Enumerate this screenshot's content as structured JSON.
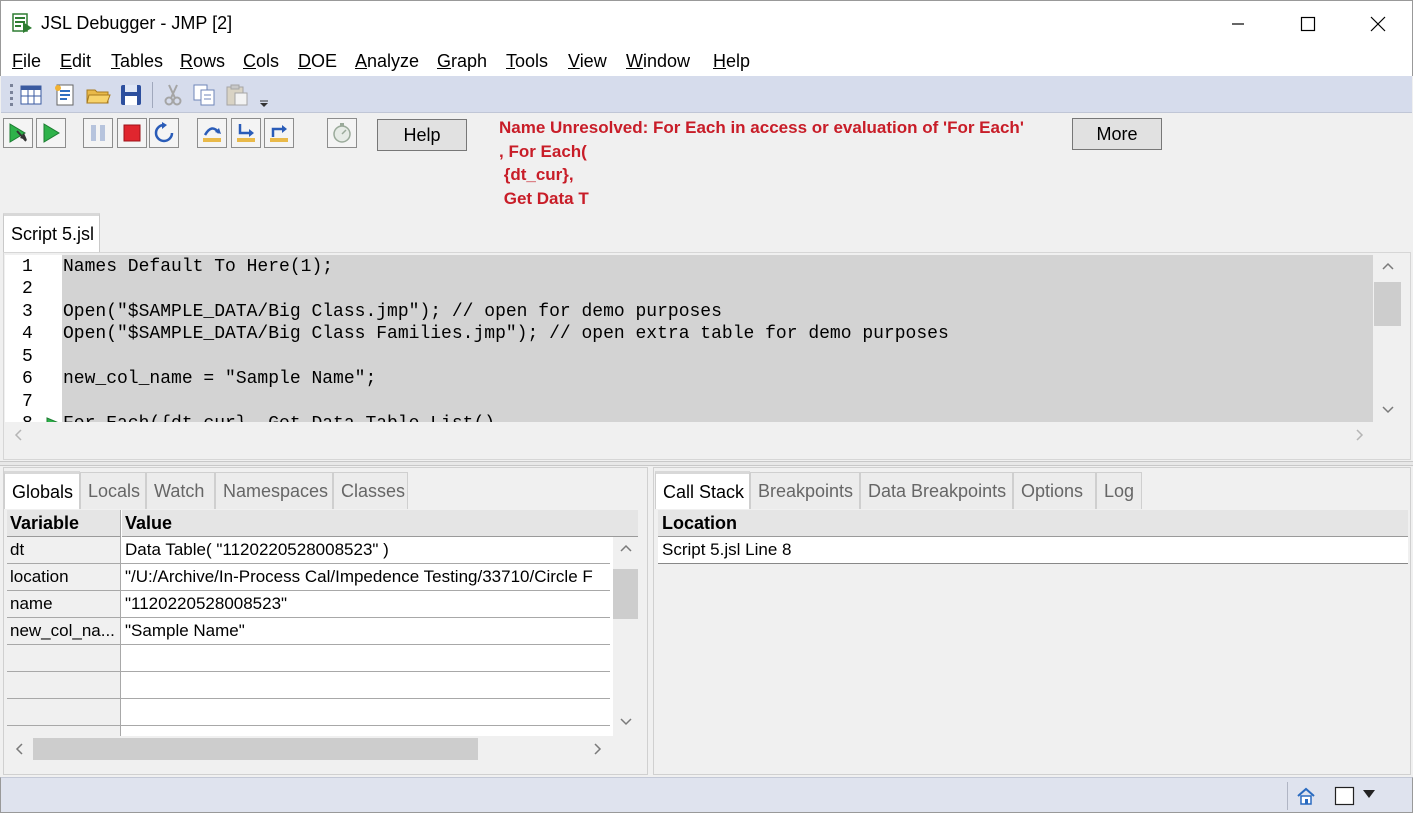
{
  "window": {
    "title": "JSL Debugger - JMP [2]"
  },
  "menu": {
    "items": [
      {
        "u": "F",
        "rest": "ile"
      },
      {
        "u": "E",
        "rest": "dit"
      },
      {
        "u": "T",
        "rest": "ables"
      },
      {
        "u": "R",
        "rest": "ows"
      },
      {
        "u": "C",
        "rest": "ols"
      },
      {
        "u": "D",
        "rest": "OE"
      },
      {
        "u": "A",
        "rest": "nalyze"
      },
      {
        "u": "G",
        "rest": "raph"
      },
      {
        "u": "T",
        "rest": "ools"
      },
      {
        "u": "V",
        "rest": "iew"
      },
      {
        "u": "W",
        "rest": "indow"
      },
      {
        "u": "H",
        "rest": "elp"
      }
    ]
  },
  "debugger": {
    "help_label": "Help",
    "more_label": "More",
    "error_lines": [
      "Name Unresolved: For Each in access or evaluation of 'For Each'",
      ", For Each(",
      " {dt_cur},",
      " Get Data T"
    ]
  },
  "script": {
    "tab_label": "Script 5.jsl",
    "lines": [
      {
        "n": "1",
        "text": "Names Default To Here(1);"
      },
      {
        "n": "2",
        "text": ""
      },
      {
        "n": "3",
        "text": "Open(\"$SAMPLE_DATA/Big Class.jmp\"); // open for demo purposes"
      },
      {
        "n": "4",
        "text": "Open(\"$SAMPLE_DATA/Big Class Families.jmp\"); // open extra table for demo purposes"
      },
      {
        "n": "5",
        "text": ""
      },
      {
        "n": "6",
        "text": "new_col_name = \"Sample Name\";"
      },
      {
        "n": "7",
        "text": ""
      },
      {
        "n": "8",
        "text": "For Each({dt_cur}, Get Data Table List(),"
      }
    ]
  },
  "left_tabs": [
    "Globals",
    "Locals",
    "Watch",
    "Namespaces",
    "Classes"
  ],
  "globals": {
    "header_variable": "Variable",
    "header_value": "Value",
    "rows": [
      {
        "name": "dt",
        "value": "Data Table( \"1120220528008523\" )"
      },
      {
        "name": "location",
        "value": "\"/U:/Archive/In-Process Cal/Impedence Testing/33710/Circle F"
      },
      {
        "name": "name",
        "value": "\"1120220528008523\""
      },
      {
        "name": "new_col_na...",
        "value": "\"Sample Name\""
      },
      {
        "name": "",
        "value": ""
      },
      {
        "name": "",
        "value": ""
      },
      {
        "name": "",
        "value": ""
      },
      {
        "name": "",
        "value": ""
      }
    ]
  },
  "right_tabs": [
    "Call Stack",
    "Breakpoints",
    "Data Breakpoints",
    "Options",
    "Log"
  ],
  "callstack": {
    "header": "Location",
    "rows": [
      "Script 5.jsl Line 8"
    ]
  },
  "colors": {
    "error": "#c81d28",
    "toolbar_bg": "#d6dcec",
    "editor_bg": "#d3d3d3"
  }
}
